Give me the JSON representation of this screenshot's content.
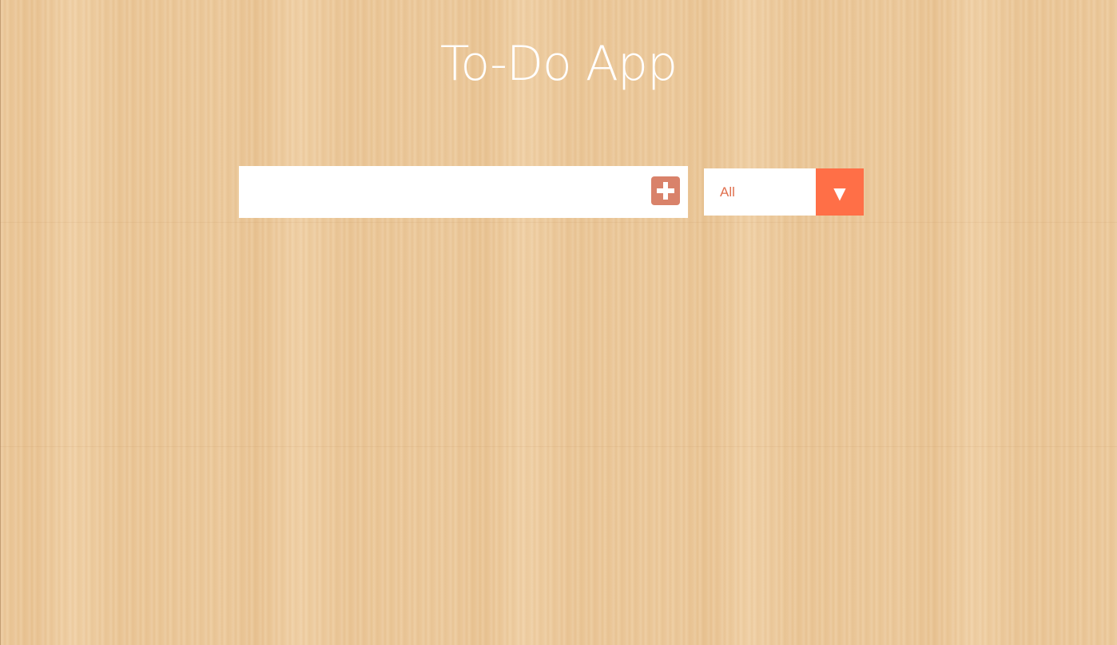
{
  "app": {
    "title": "To-Do App"
  },
  "todo_input": {
    "value": "",
    "placeholder": ""
  },
  "add_button": {
    "icon": "plus-square-icon"
  },
  "filter": {
    "selected": "All",
    "arrow_glyph": "▼"
  },
  "colors": {
    "accent": "#ff6f47",
    "add_button": "#d9826a",
    "filter_text": "#e0704f",
    "title": "#ffffff"
  }
}
